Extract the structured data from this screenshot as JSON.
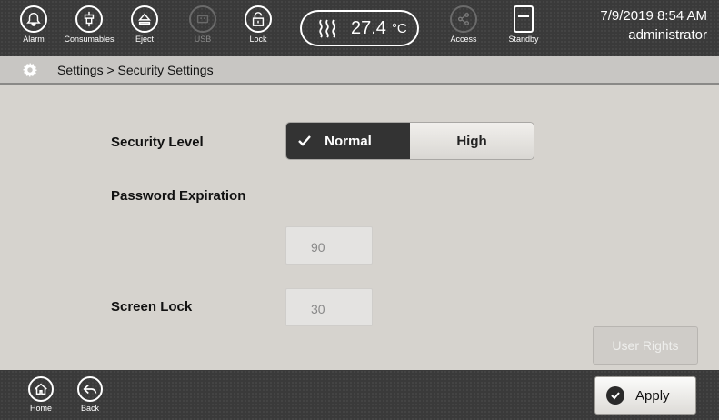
{
  "topbar": {
    "buttons": [
      {
        "label": "Alarm",
        "icon": "bell-icon"
      },
      {
        "label": "Consumables",
        "icon": "consumables-icon"
      },
      {
        "label": "Eject",
        "icon": "eject-icon"
      },
      {
        "label": "USB",
        "icon": "usb-icon",
        "disabled": true
      },
      {
        "label": "Lock",
        "icon": "lock-icon"
      }
    ],
    "temperature": {
      "value": "27.4",
      "unit": "°C",
      "icon": "heater-icon"
    },
    "access": {
      "label": "Access",
      "icon": "share-icon",
      "disabled": true
    },
    "standby": {
      "label": "Standby",
      "icon": "standby-icon"
    },
    "datetime": "7/9/2019 8:54 AM",
    "user": "administrator"
  },
  "breadcrumb": {
    "text": "Settings > Security Settings",
    "icon": "gear-icon"
  },
  "security": {
    "security_level_label": "Security Level",
    "options": [
      {
        "label": "Normal",
        "selected": true
      },
      {
        "label": "High",
        "selected": false
      }
    ],
    "password_expiration_label": "Password Expiration",
    "password_expiration_value": "90",
    "screen_lock_label": "Screen Lock",
    "screen_lock_value": "30",
    "user_rights_label": "User Rights"
  },
  "bottombar": {
    "home_label": "Home",
    "back_label": "Back",
    "apply_label": "Apply"
  },
  "colors": {
    "bar_bg": "#3a3a3a",
    "content_bg": "#d6d3ce",
    "selected_option_bg": "#333333"
  }
}
